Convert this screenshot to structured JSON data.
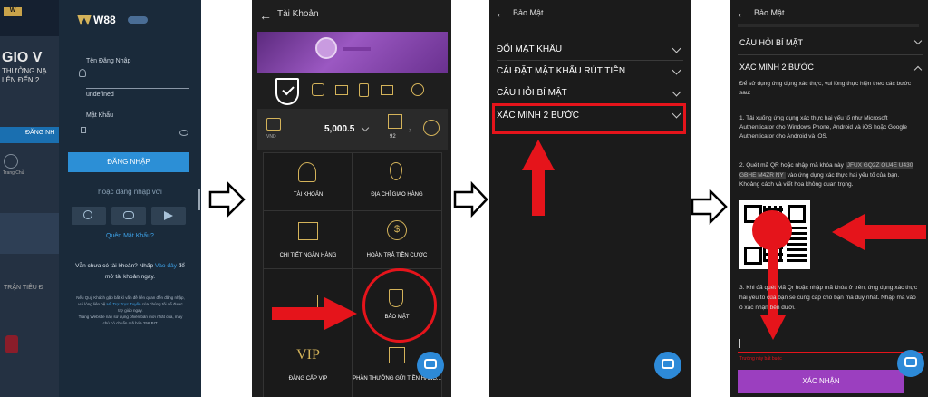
{
  "panel1": {
    "logo": "W88",
    "bg_lines": [
      "GIO V",
      "THƯỞNG NẠ",
      "LÊN ĐẾN 2."
    ],
    "username_label": "Tên Đăng Nhập",
    "username_value": "undefined",
    "password_label": "Mật Khẩu",
    "login_button": "ĐĂNG NHẬP",
    "or_login_with": "hoặc đăng nhập với",
    "forgot_password": "Quên Mật Khẩu?",
    "no_account_1": "Vẫn chưa có tài khoản? Nhấp",
    "no_account_link": "Vào đây",
    "no_account_2": "để",
    "no_account_3": "mở tài khoản ngay.",
    "notice_1": "Nếu Quý Khách gặp bất kì vấn đề liên quan đến đăng nhập,",
    "notice_2": "vui lòng liên hệ",
    "notice_link": "Hỗ Trợ Trực Tuyến",
    "notice_3": "của chúng tôi để được",
    "notice_4": "trợ giúp ngay.",
    "notice_5": "Trang Website này sử dụng phiên bản mới nhất của, máy",
    "notice_6": "chủ có chuẩn mã hóa 256 BIT.",
    "side_login": "ĐĂNG NH",
    "side_home": "Trang Chủ",
    "side_trending": "TRẬN TIÊU Đ"
  },
  "panel2": {
    "title": "Tài Khoản",
    "currency": "VND",
    "balance": "5,000.5",
    "gift_count": "92",
    "menu": [
      {
        "label": "TÀI KHOẢN"
      },
      {
        "label": "ĐỊA CHỈ GIAO HÀNG"
      },
      {
        "label": "CHI TIẾT NGÂN HÀNG"
      },
      {
        "label": "HOÀN TRẢ TIỀN CƯỢC"
      },
      {
        "label": ""
      },
      {
        "label": "BẢO MẬT"
      },
      {
        "label": "ĐẲNG CẤP VIP"
      },
      {
        "label": "PHẦN THƯỞNG GỬI TIỀN HÀNG..."
      }
    ],
    "vip_text": "VIP"
  },
  "panel3": {
    "title": "Bảo Mật",
    "rows": [
      {
        "label": "ĐỔI MẬT KHẨU"
      },
      {
        "label": "CÀI ĐẶT MẬT KHẨU RÚT TIỀN"
      },
      {
        "label": "CÂU HỎI BÍ MẬT"
      },
      {
        "label": "XÁC MINH 2 BƯỚC"
      }
    ]
  },
  "panel4": {
    "title": "Bảo Mật",
    "security_question": "CÂU HỎI BÍ MẬT",
    "two_step": "XÁC MINH 2 BƯỚC",
    "intro": "Để sử dụng ứng dụng xác thực, vui lòng thực hiện theo các bước sau:",
    "step1": "1. Tải xuống ứng dụng xác thực hai yếu tố như Microsoft Authenticator cho Windows Phone, Android và iOS hoặc Google Authenticator cho Android và iOS.",
    "step2_a": "2. Quét mã QR hoặc nhập mã khóa này",
    "step2_key": "JFUX GQ2Z OU4E U430 GBHE M4ZR NY",
    "step2_b": "vào ứng dụng xác thực hai yếu tố của bạn. Khoảng cách và viết hoa không quan trọng.",
    "step3": "3. Khi đã quét Mã Qr hoặc nhập mã khóa ở trên, ứng dụng xác thực hai yếu tố của bạn sẽ cung cấp cho bạn mã duy nhất. Nhập mã vào ô xác nhận bên dưới.",
    "required": "Trường này bắt buộc",
    "confirm_button": "XÁC NHẬN"
  },
  "colors": {
    "accent_blue": "#2c8fd6",
    "highlight_red": "#e5141b",
    "confirm_purple": "#9b3fbf"
  }
}
